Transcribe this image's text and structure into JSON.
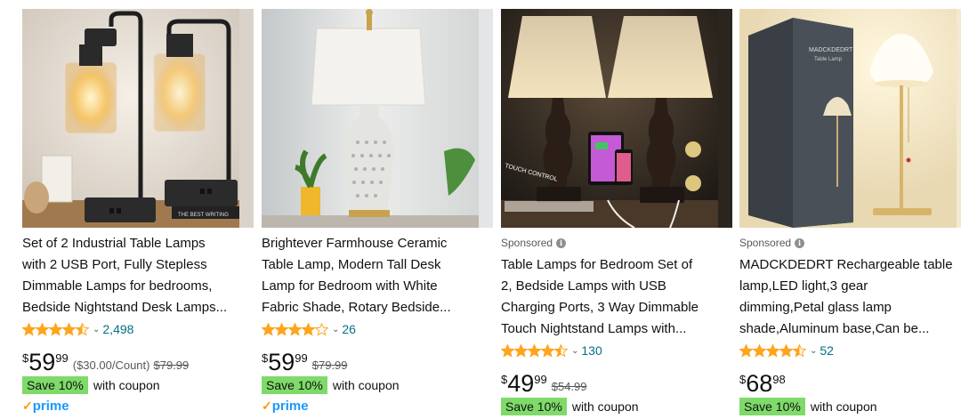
{
  "colors": {
    "link": "#007185",
    "star": "#ffa41c",
    "coupon_bg": "#7fda69",
    "prime": "#1a98ff"
  },
  "products": [
    {
      "image_desc": "two industrial table lamps",
      "sponsored": "",
      "title_lines": [
        "Set of 2 Industrial Table Lamps",
        "with 2 USB Port, Fully Stepless",
        "Dimmable Lamps for bedrooms,",
        "Bedside Nightstand Desk Lamps..."
      ],
      "rating": 4.5,
      "rating_count": "2,498",
      "price_symbol": "$",
      "price_whole": "59",
      "price_fraction": "99",
      "unit_price": "($30.00/Count)",
      "list_price": "$79.99",
      "coupon_badge": "Save 10%",
      "coupon_text": "with coupon",
      "prime_label": "prime"
    },
    {
      "image_desc": "ceramic farmhouse lamp",
      "sponsored": "",
      "title_lines": [
        "Brightever Farmhouse Ceramic",
        "Table Lamp, Modern Tall Desk",
        "Lamp for Bedroom with White",
        "Fabric Shade, Rotary Bedside..."
      ],
      "rating": 4.0,
      "rating_count": "26",
      "price_symbol": "$",
      "price_whole": "59",
      "price_fraction": "99",
      "unit_price": "",
      "list_price": "$79.99",
      "coupon_badge": "Save 10%",
      "coupon_text": "with coupon",
      "prime_label": "prime"
    },
    {
      "image_desc": "pair of bedside touch lamps",
      "sponsored": "Sponsored",
      "title_lines": [
        "Table Lamps for Bedroom Set of",
        "2, Bedside Lamps with USB",
        "Charging Ports, 3 Way Dimmable",
        "Touch Nightstand Lamps with..."
      ],
      "rating": 4.5,
      "rating_count": "130",
      "price_symbol": "$",
      "price_whole": "49",
      "price_fraction": "99",
      "unit_price": "",
      "list_price": "$54.99",
      "coupon_badge": "Save 10%",
      "coupon_text": "with coupon",
      "prime_label": ""
    },
    {
      "image_desc": "rechargeable petal glass lamp",
      "sponsored": "Sponsored",
      "title_lines": [
        "MADCKDEDRT Rechargeable table",
        "lamp,LED light,3 gear",
        "dimming,Petal glass lamp",
        "shade,Aluminum base,Can be..."
      ],
      "rating": 4.5,
      "rating_count": "52",
      "price_symbol": "$",
      "price_whole": "68",
      "price_fraction": "98",
      "unit_price": "",
      "list_price": "",
      "coupon_badge": "Save 10%",
      "coupon_text": "with coupon",
      "prime_label": ""
    }
  ],
  "icons": {
    "rating_chevron": "chevron-down-icon",
    "info": "info-icon",
    "prime_check": "prime-check-icon"
  },
  "image_text": {
    "book_spine": "THE BEST WRITING",
    "touch_control": "TOUCH CONTROL",
    "box_brand": "MADCKDEDRT",
    "box_subtitle": "Table Lamp"
  }
}
